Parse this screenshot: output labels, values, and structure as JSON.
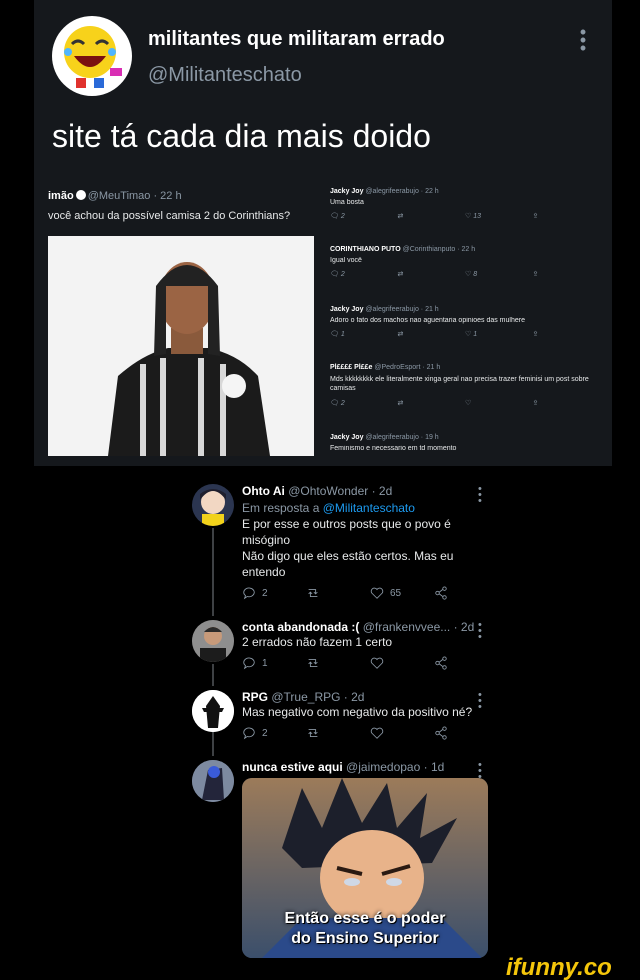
{
  "top_tweet": {
    "name": "militantes que militaram errado",
    "handle": "@Militanteschato",
    "text": "site tá cada dia mais doido"
  },
  "embed": {
    "left": {
      "name": "imão",
      "handle_time": "@MeuTimao · 22 h",
      "text": "você achou da possível camisa 2 do Corinthians?"
    },
    "right": [
      {
        "name": "Jacky Joy",
        "meta": "@alegrifeerabujo · 22 h",
        "text": "Uma bosta",
        "counts": [
          "2",
          "",
          "13",
          ""
        ]
      },
      {
        "name": "CORINTHIANO PUTO",
        "meta": "@Corinthianputo · 22 h",
        "text": "Igual você",
        "counts": [
          "2",
          "",
          "8",
          ""
        ]
      },
      {
        "name": "Jacky Joy",
        "meta": "@alegrifeerabujo · 21 h",
        "text": "Adoro o fato dos machos nao aguentaria opinioes das mulhere",
        "counts": [
          "1",
          "",
          "1",
          ""
        ]
      },
      {
        "name": "Pl££££ Pl££e",
        "meta": "@PedroEsport · 21 h",
        "text": "Mds kkkkkkkk ele literalmente xinga geral nao precisa trazer feminisi um post sobre camisas",
        "counts": [
          "2",
          "",
          "",
          ""
        ]
      },
      {
        "name": "Jacky Joy",
        "meta": "@alegrifeerabujo · 19 h",
        "text": "Feminismo e necessario em td momento",
        "counts": [
          "",
          "",
          "",
          ""
        ]
      }
    ]
  },
  "replies": [
    {
      "name": "Ohto Ai",
      "meta": "@OhtoWonder · 2d",
      "reply_to_prefix": "Em resposta a",
      "reply_to": "@Militanteschato",
      "text_lines": [
        "E por esse e outros posts que o povo é",
        "misógino",
        "Não digo que eles estão certos. Mas eu",
        "entendo"
      ],
      "reply_count": "2",
      "retweet_count": "",
      "like_count": "65"
    },
    {
      "name": "conta abandonada :(",
      "meta": "@frankenvvee...  · 2d",
      "text_lines": [
        "2 errados não fazem 1 certo"
      ],
      "reply_count": "1",
      "retweet_count": "",
      "like_count": ""
    },
    {
      "name": "RPG",
      "meta": "@True_RPG · 2d",
      "text_lines": [
        "Mas negativo com negativo da positivo né?"
      ],
      "reply_count": "2",
      "retweet_count": "",
      "like_count": ""
    },
    {
      "name": "nunca estive aqui",
      "meta": "@jaimedopao · 1d",
      "text_lines": [],
      "meme_caption": [
        "Então esse é o poder",
        "do Ensino Superior"
      ]
    }
  ],
  "watermark": "ifunny.co",
  "colors": {
    "background": "#000000",
    "card": "#15181c",
    "link": "#1d9bf0",
    "muted": "#8b98a5",
    "watermark": "#f4c60b"
  }
}
